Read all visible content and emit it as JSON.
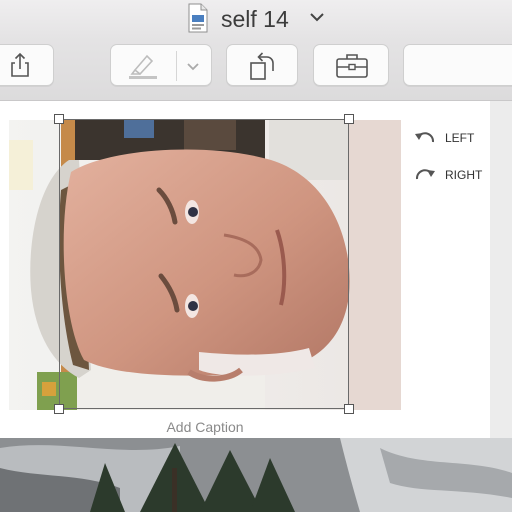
{
  "window": {
    "title": "self 14",
    "doc_icon": "document-icon",
    "title_chevron_icon": "chevron-down-icon"
  },
  "toolbar": {
    "share_icon": "share-icon",
    "markup_icon": "highlighter-icon",
    "markup_menu_icon": "chevron-down-icon",
    "rotate_icon": "rotate-icon",
    "toolbox_icon": "toolbox-icon"
  },
  "editor": {
    "rotate_left_label": "LEFT",
    "rotate_right_label": "RIGHT",
    "rotate_left_icon": "rotate-left-icon",
    "rotate_right_icon": "rotate-right-icon",
    "caption_placeholder": "Add Caption",
    "photo": "portrait photo rotated sideways"
  },
  "colors": {
    "chrome": "#e4e3e4",
    "button_bg": "#fbfbfb",
    "content_bg": "#ffffff",
    "caption_text": "#8a8a8a"
  }
}
